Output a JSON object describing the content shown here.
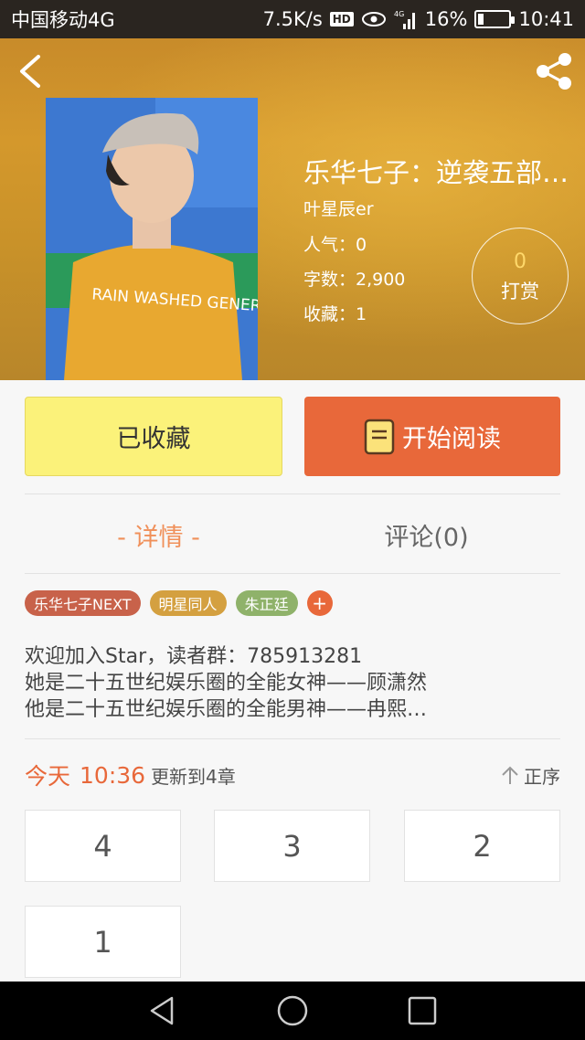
{
  "status_bar": {
    "carrier": "中国移动4G",
    "speed": "7.5K/s",
    "hd": "HD",
    "network": "4G",
    "battery": "16%",
    "battery_level": 0.16,
    "time": "10:41"
  },
  "book": {
    "title": "乐华七子：逆袭五部…",
    "author": "叶星辰er",
    "popularity": "人气：0",
    "word_count": "字数：2,900",
    "favorites": "收藏：1",
    "reward_count": "0",
    "reward_label": "打赏",
    "cover_text": "RAIN WASHED GENERATIO"
  },
  "actions": {
    "favorited_label": "已收藏",
    "read_label": "开始阅读"
  },
  "tabs": {
    "detail": "- 详情 -",
    "comments": "评论(0)"
  },
  "tags": [
    {
      "label": "乐华七子NEXT",
      "color": "#c8624a"
    },
    {
      "label": "明星同人",
      "color": "#d4a040"
    },
    {
      "label": "朱正廷",
      "color": "#8fb26a"
    }
  ],
  "tag_add": "+",
  "intro": {
    "line1": "欢迎加入Star，读者群：785913281",
    "line2": "她是二十五世纪娱乐圈的全能女神——顾潇然",
    "line3": "他是二十五世纪娱乐圈的全能男神——冉熙…"
  },
  "update": {
    "day": "今天",
    "time": "10:36",
    "text": "更新到4章",
    "sort_label": "正序"
  },
  "chapters": [
    "4",
    "3",
    "2",
    "1"
  ],
  "colors": {
    "accent": "#e8683a",
    "favorite_button": "#fbf27a"
  }
}
